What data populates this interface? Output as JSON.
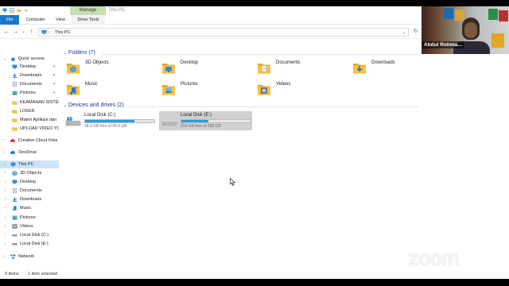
{
  "window": {
    "title": "This PC",
    "manage_tab": "Manage"
  },
  "ribbon": {
    "tabs": [
      {
        "label": "File"
      },
      {
        "label": "Computer"
      },
      {
        "label": "View"
      },
      {
        "label": "Drive Tools"
      }
    ]
  },
  "address": {
    "path": "This PC"
  },
  "navpane": {
    "items": [
      {
        "label": "Quick access",
        "icon": "star-icon"
      },
      {
        "label": "Desktop",
        "icon": "desktop-icon",
        "pinned": true
      },
      {
        "label": "Downloads",
        "icon": "download-icon",
        "pinned": true
      },
      {
        "label": "Documents",
        "icon": "documents-icon",
        "pinned": true
      },
      {
        "label": "Pictures",
        "icon": "pictures-icon",
        "pinned": true
      },
      {
        "label": "KEAMANAN SISTEM",
        "icon": "folder-icon"
      },
      {
        "label": "LOKER",
        "icon": "folder-icon"
      },
      {
        "label": "Materi Aplikasi dan",
        "icon": "folder-icon"
      },
      {
        "label": "UPLOAD VIDEO YO",
        "icon": "folder-icon"
      },
      {
        "label": "Creative Cloud Files",
        "icon": "creative-cloud-icon"
      },
      {
        "label": "OneDrive",
        "icon": "cloud-icon"
      },
      {
        "label": "This PC",
        "icon": "computer-icon",
        "selected": true
      },
      {
        "label": "3D Objects",
        "icon": "cube-icon"
      },
      {
        "label": "Desktop",
        "icon": "desktop-icon"
      },
      {
        "label": "Documents",
        "icon": "documents-icon"
      },
      {
        "label": "Downloads",
        "icon": "download-icon"
      },
      {
        "label": "Music",
        "icon": "music-icon"
      },
      {
        "label": "Pictures",
        "icon": "pictures-icon"
      },
      {
        "label": "Videos",
        "icon": "videos-icon"
      },
      {
        "label": "Local Disk (C:)",
        "icon": "drive-icon"
      },
      {
        "label": "Local Disk (E:)",
        "icon": "drive-icon"
      },
      {
        "label": "Network",
        "icon": "network-icon"
      }
    ]
  },
  "content": {
    "folders_header": "Folders (7)",
    "folders": [
      {
        "label": "3D Objects",
        "icon": "cube-folder-icon"
      },
      {
        "label": "Desktop",
        "icon": "desktop-folder-icon"
      },
      {
        "label": "Documents",
        "icon": "documents-folder-icon"
      },
      {
        "label": "Downloads",
        "icon": "downloads-folder-icon"
      },
      {
        "label": "Music",
        "icon": "music-folder-icon"
      },
      {
        "label": "Pictures",
        "icon": "pictures-folder-icon"
      },
      {
        "label": "Videos",
        "icon": "videos-folder-icon"
      }
    ],
    "drives_header": "Devices and drives (2)",
    "drives": [
      {
        "label": "Local Disk (C:)",
        "free_text": "28.3 GB free of 96.5 GB",
        "used_fraction": 0.707,
        "icon": "windows-drive-icon"
      },
      {
        "label": "Local Disk (E:)",
        "free_text": "224 GB free of 368 GB",
        "used_fraction": 0.391,
        "icon": "drive-icon",
        "selected": true
      }
    ]
  },
  "status": {
    "count": "9 items",
    "selection": "1 item selected"
  },
  "video": {
    "participant_name": "Abdul Rohma..."
  },
  "watermark": "zoom",
  "colors": {
    "accent": "#1979ca",
    "drive_bar": "#26a0da",
    "folder": "#f6c14a",
    "selected_nav": "#cce4f7"
  }
}
